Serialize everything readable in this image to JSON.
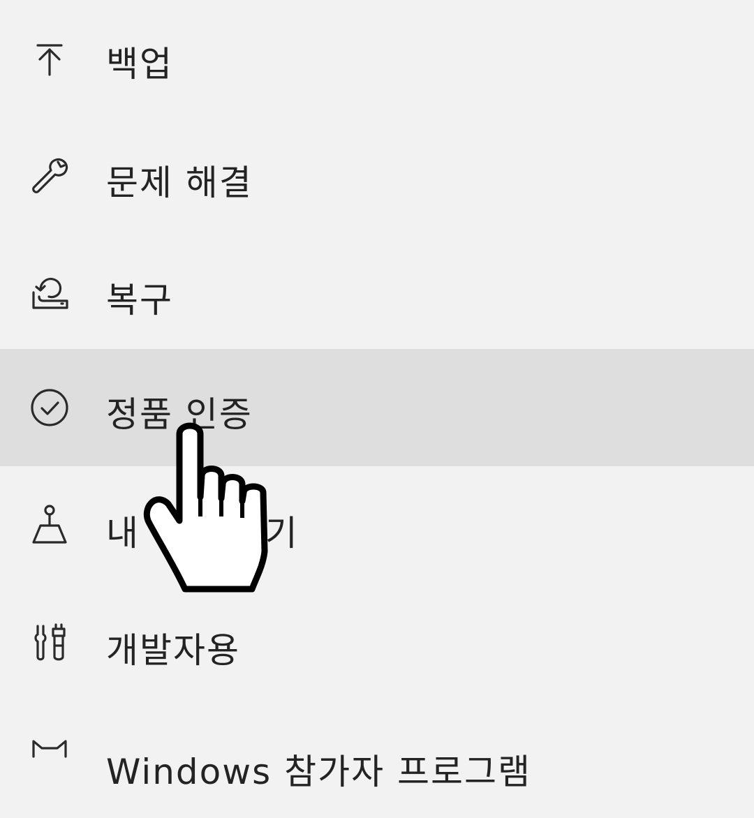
{
  "menu": {
    "items": [
      {
        "label": "백업",
        "icon": "backup-arrow-icon",
        "selected": false
      },
      {
        "label": "문제 해결",
        "icon": "wrench-icon",
        "selected": false
      },
      {
        "label": "복구",
        "icon": "recovery-icon",
        "selected": false
      },
      {
        "label": "정품 인증",
        "icon": "check-circle-icon",
        "selected": true
      },
      {
        "label": "내 장치 찾기",
        "icon": "find-device-icon",
        "selected": false
      },
      {
        "label": "개발자용",
        "icon": "developer-tools-icon",
        "selected": false
      },
      {
        "label": "Windows 참가자 프로그램",
        "icon": "insider-cat-icon",
        "selected": false
      }
    ]
  },
  "cursor": {
    "icon": "hand-pointer-cursor"
  },
  "colors": {
    "background": "#f2f2f2",
    "selected_background": "#dedede",
    "text": "#232323"
  }
}
